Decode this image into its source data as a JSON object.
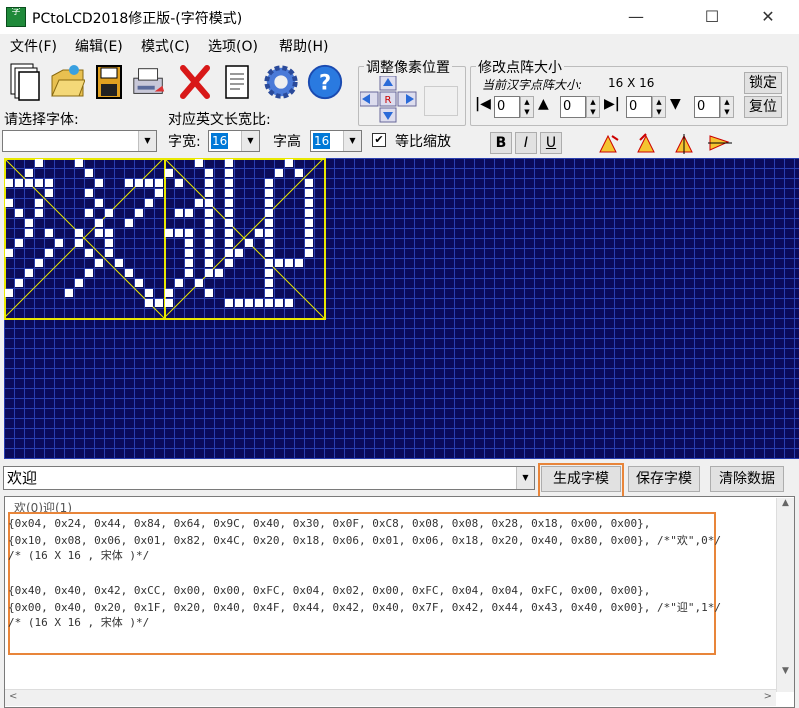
{
  "window": {
    "title": "PCtoLCD2018修正版-(字符模式)",
    "icon_text": "字",
    "controls": {
      "minimize": "—",
      "maximize": "☐",
      "close": "✕"
    }
  },
  "menu": [
    "文件(F)",
    "编辑(E)",
    "模式(C)",
    "选项(O)",
    "帮助(H)"
  ],
  "toolbar": {
    "icons": [
      "new-file-icon",
      "open-folder-icon",
      "save-disk-icon",
      "print-icon",
      "delete-x-icon",
      "document-icon",
      "gear-icon",
      "help-icon"
    ]
  },
  "font_select": {
    "label": "请选择字体:",
    "value": ""
  },
  "width_height": {
    "label": "对应英文长宽比:",
    "width_label": "字宽:",
    "width_value": "16",
    "height_label": "字高",
    "height_value": "16",
    "scale_label": "等比缩放",
    "scale_checked": true
  },
  "pixel_adjust": {
    "title": "调整像素位置",
    "center_label": "R"
  },
  "dot_size": {
    "title": "修改点阵大小",
    "current_label": "当前汉字点阵大小:",
    "current_value": "16  X  16",
    "lock_button": "锁定",
    "reset_button": "复位",
    "spin_values": [
      "0",
      "0",
      "0",
      "0"
    ]
  },
  "style_buttons": {
    "bold": "B",
    "italic": "I",
    "underline": "U"
  },
  "grid": {
    "chars": [
      {
        "char": "欢",
        "pixels": [
          "...X...X........",
          "..X.....X.......",
          "XXXXX....X..XXXX",
          "....X...X......X",
          "X..X.....X....X.",
          ".X.X....X.X..X..",
          "..X......X..X...",
          "..X.X..X.XX.....",
          ".X...X.X..X.....",
          "X...X...X.X.....",
          "...X.....X.X....",
          "..X.....X...X...",
          ".X.....X.....X..",
          "X.....X.......X.",
          "..............XX",
          "................"
        ]
      },
      {
        "char": "迎",
        "pixels": [
          "...X..X.....X...",
          "X...X.X....X.X..",
          ".X..X.X...X...X.",
          "....X.X...X...X.",
          "...XX.X...X...X.",
          ".XX.X.X...X...X.",
          "....X.X...X...X.",
          "XXX.X.X..XX...X.",
          "..X.X.X.X.X...X.",
          "..X.X.XX..X...X.",
          "..X.X.X...XXXX..",
          "..X.XX....X.....",
          ".X.X......X.....",
          "X...X.....X.....",
          "X.....XXXXXXX...",
          "................"
        ]
      }
    ]
  },
  "input": {
    "value": "欢迎"
  },
  "actions": {
    "generate": "生成字模",
    "save": "保存字模",
    "clear": "清除数据"
  },
  "output": {
    "header": "欢(0)迎(1)",
    "lines": [
      "{0x04, 0x24, 0x44, 0x84, 0x64, 0x9C, 0x40, 0x30, 0x0F, 0xC8, 0x08, 0x08, 0x28, 0x18, 0x00, 0x00},",
      "{0x10, 0x08, 0x06, 0x01, 0x82, 0x4C, 0x20, 0x18, 0x06, 0x01, 0x06, 0x18, 0x20, 0x40, 0x80, 0x00}, /*\"欢\",0*/",
      "/* (16 X 16 , 宋体 )*/",
      "",
      "{0x40, 0x40, 0x42, 0xCC, 0x00, 0x00, 0xFC, 0x04, 0x02, 0x00, 0xFC, 0x04, 0x04, 0xFC, 0x00, 0x00},",
      "{0x00, 0x40, 0x20, 0x1F, 0x20, 0x40, 0x4F, 0x44, 0x42, 0x40, 0x7F, 0x42, 0x44, 0x43, 0x40, 0x00}, /*\"迎\",1*/",
      "/* (16 X 16 , 宋体 )*/"
    ]
  },
  "accent": {
    "highlight": "#e8853a",
    "grid_bg": "#0b0b5a",
    "guide": "#e8e800"
  }
}
